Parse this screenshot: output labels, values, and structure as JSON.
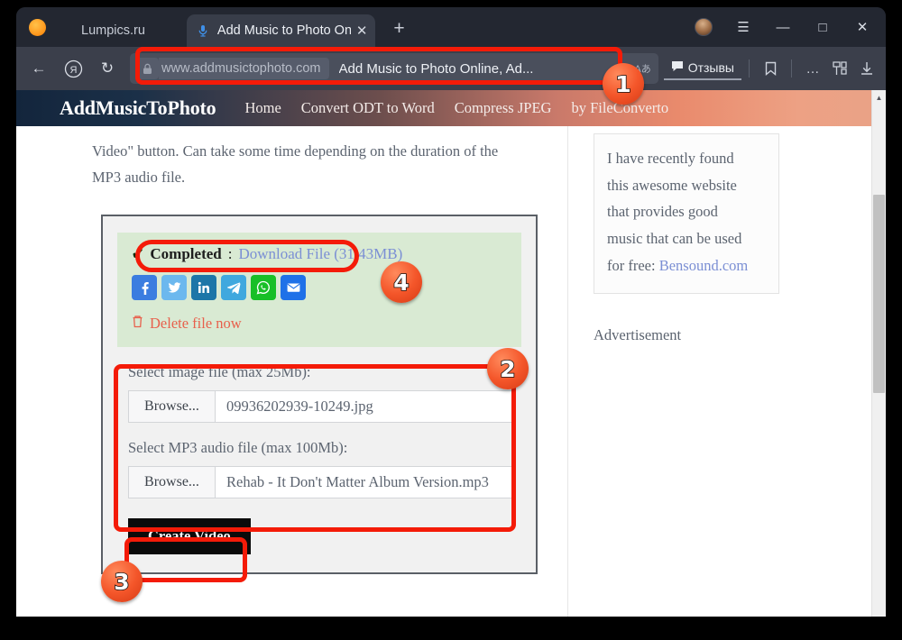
{
  "browser": {
    "name": "yandex-browser",
    "tabs": [
      {
        "title": "Lumpics.ru",
        "active": false,
        "icon": "favicon"
      },
      {
        "title": "Add Music to Photo Onl",
        "active": true,
        "icon": "microphone-icon",
        "close": "✕"
      }
    ],
    "new_tab_label": "+",
    "window_controls": {
      "minimize": "—",
      "maximize": "□",
      "close": "✕",
      "menu": "☰"
    },
    "nav": {
      "back": "←",
      "yandex": "Я",
      "reload": "↻",
      "lock_icon": "lock-icon",
      "url": "www.addmusictophoto.com",
      "page_title": "Add Music to Photo Online, Ad...",
      "translate_icon": "Aあ"
    },
    "toolbar": {
      "reviews_label": "Отзывы",
      "bookmark_icon": "bookmark-icon",
      "more_icon": "…",
      "collections_icon": "collections-icon",
      "downloads_icon": "download-icon"
    }
  },
  "site": {
    "brand": "AddMusicToPhoto",
    "nav_links": [
      "Home",
      "Convert ODT to Word",
      "Compress JPEG",
      "by FileConverto"
    ],
    "intro_line1": "Video\" button. Can take some time depending on the duration of the",
    "intro_line2": "MP3 audio file.",
    "success": {
      "check": "✔",
      "status_label": "Completed",
      "separator": ":",
      "download_link": "Download File (31.43MB)",
      "delete_label": "Delete file now",
      "trash_icon": "trash-icon",
      "socials": [
        {
          "name": "facebook",
          "color": "#3b7de0"
        },
        {
          "name": "twitter",
          "color": "#6cb8ee"
        },
        {
          "name": "linkedin",
          "color": "#1c76a8"
        },
        {
          "name": "telegram",
          "color": "#40a8de"
        },
        {
          "name": "whatsapp",
          "color": "#18bf27"
        },
        {
          "name": "email",
          "color": "#1f71e8"
        }
      ]
    },
    "form": {
      "image_label": "Select image file (max 25Mb):",
      "image_browse": "Browse...",
      "image_file": "09936202939-10249.jpg",
      "audio_label": "Select MP3 audio file (max 100Mb):",
      "audio_browse": "Browse...",
      "audio_file": "Rehab - It Don't Matter Album Version.mp3",
      "submit_label": "Create Video"
    },
    "sidebar": {
      "quote_lines": [
        "I have recently found",
        "this awesome website",
        "that provides good",
        "music that can be used",
        "for free: "
      ],
      "quote_link": "Bensound.com",
      "ad_label": "Advertisement"
    }
  },
  "annotations": {
    "badges": [
      {
        "number": "1",
        "target": "address-bar"
      },
      {
        "number": "2",
        "target": "file-inputs"
      },
      {
        "number": "3",
        "target": "create-video-button"
      },
      {
        "number": "4",
        "target": "completed-download"
      }
    ],
    "highlight_color": "#f41b08"
  },
  "scrollbar": {
    "up": "▲",
    "down": "▼"
  }
}
